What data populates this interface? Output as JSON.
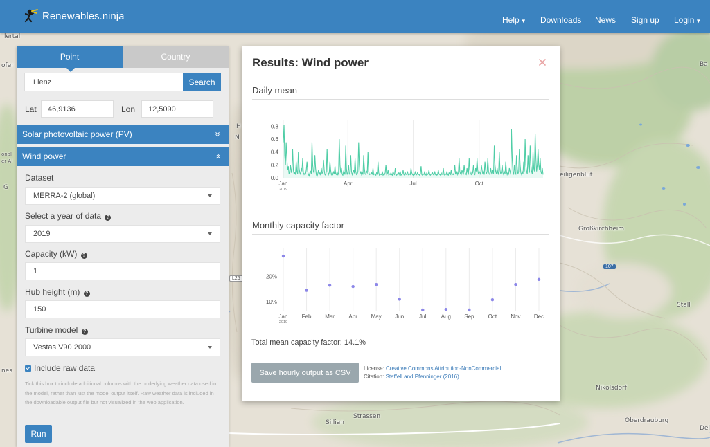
{
  "app": {
    "brand": "Renewables.ninja",
    "nav": [
      "Help",
      "Downloads",
      "News",
      "Sign up",
      "Login"
    ],
    "colors": {
      "primary": "#3b83c0",
      "panel_bg": "#ececec",
      "chart_line": "#4fcda6",
      "chart_dot": "#8c87e8"
    }
  },
  "map": {
    "labels": [
      "lertal",
      "Ba",
      "ofer",
      "H",
      "N",
      "onal",
      "er Al",
      "G",
      "eiligenblut",
      "Großkirchheim",
      "Stall",
      "Nikolsdorf",
      "Sillian",
      "Strassen",
      "Oberdrauburg",
      "Del",
      "nes"
    ],
    "road_badges": [
      "L25",
      "107"
    ]
  },
  "panel": {
    "tabs": [
      "Point",
      "Country"
    ],
    "search": {
      "value": "Lienz",
      "button": "Search"
    },
    "lat_label": "Lat",
    "lat_value": "46,9136",
    "lon_label": "Lon",
    "lon_value": "12,5090",
    "sections": [
      {
        "label": "Solar photovoltaic power (PV)",
        "icon": "double-chevron-down"
      },
      {
        "label": "Wind power",
        "icon": "double-chevron-up"
      }
    ],
    "fields": {
      "dataset": {
        "label": "Dataset",
        "value": "MERRA-2 (global)"
      },
      "year": {
        "label": "Select a year of data",
        "value": "2019"
      },
      "capacity": {
        "label": "Capacity (kW)",
        "value": "1"
      },
      "hub_height": {
        "label": "Hub height (m)",
        "value": "150"
      },
      "turbine": {
        "label": "Turbine model",
        "value": "Vestas V90 2000"
      }
    },
    "include_raw": {
      "label": "Include raw data",
      "checked": true,
      "help": "Tick this box to include additional columns with the underlying weather data used in the model, rather than just the model output itself. Raw weather data is included in the downloadable output file but not visualized in the web application."
    },
    "run_button": "Run"
  },
  "results": {
    "title": "Results: Wind power",
    "daily_title": "Daily mean",
    "monthly_title": "Monthly capacity factor",
    "total_text": "Total mean capacity factor: 14.1%",
    "save_button": "Save hourly output as CSV",
    "license_label": "License:",
    "license_link": "Creative Commons Attribution-NonCommercial",
    "citation_label": "Citation:",
    "citation_link": "Staffell and Pfenninger (2016)"
  },
  "chart_data": [
    {
      "type": "area",
      "title": "Daily mean",
      "x_ticks": [
        "Jan",
        "Apr",
        "Jul",
        "Oct"
      ],
      "x_tick_sub": "2019",
      "ylim": [
        0,
        0.9
      ],
      "y_ticks": [
        0.0,
        0.2,
        0.4,
        0.6,
        0.8
      ],
      "series": [
        {
          "values": [
            0.55,
            0.82,
            0.35,
            0.2,
            0.55,
            0.3,
            0.12,
            0.18,
            0.06,
            0.1,
            0.2,
            0.08,
            0.15,
            0.45,
            0.12,
            0.06,
            0.08,
            0.05,
            0.25,
            0.1,
            0.06,
            0.4,
            0.15,
            0.08,
            0.05,
            0.15,
            0.1,
            0.3,
            0.08,
            0.05,
            0.07,
            0.06,
            0.12,
            0.25,
            0.1,
            0.05,
            0.03,
            0.08,
            0.1,
            0.06,
            0.55,
            0.2,
            0.1,
            0.07,
            0.35,
            0.15,
            0.05,
            0.02,
            0.06,
            0.12,
            0.05,
            0.08,
            0.04,
            0.15,
            0.06,
            0.1,
            0.28,
            0.12,
            0.05,
            0.04,
            0.1,
            0.45,
            0.1,
            0.05,
            0.08,
            0.25,
            0.12,
            0.05,
            0.07,
            0.05,
            0.1,
            0.06,
            0.18,
            0.06,
            0.05,
            0.1,
            0.04,
            0.08,
            0.6,
            0.2,
            0.08,
            0.15,
            0.06,
            0.04,
            0.1,
            0.08,
            0.05,
            0.5,
            0.15,
            0.05,
            0.08,
            0.2,
            0.06,
            0.05,
            0.35,
            0.1,
            0.05,
            0.08,
            0.12,
            0.07,
            0.3,
            0.1,
            0.05,
            0.06,
            0.1,
            0.55,
            0.2,
            0.06,
            0.1,
            0.05,
            0.08,
            0.05,
            0.35,
            0.15,
            0.06,
            0.05,
            0.1,
            0.08,
            0.4,
            0.1,
            0.05,
            0.06,
            0.05,
            0.08,
            0.05,
            0.15,
            0.05,
            0.06,
            0.05,
            0.04,
            0.08,
            0.05,
            0.25,
            0.08,
            0.04,
            0.06,
            0.05,
            0.05,
            0.1,
            0.04,
            0.06,
            0.05,
            0.08,
            0.2,
            0.05,
            0.06,
            0.12,
            0.04,
            0.06,
            0.05,
            0.08,
            0.05,
            0.04,
            0.1,
            0.06,
            0.05,
            0.15,
            0.05,
            0.04,
            0.06,
            0.05,
            0.08,
            0.05,
            0.1,
            0.04,
            0.05,
            0.06,
            0.12,
            0.05,
            0.04,
            0.08,
            0.05,
            0.06,
            0.1,
            0.05,
            0.04,
            0.06,
            0.05,
            0.15,
            0.08,
            0.05,
            0.04,
            0.06,
            0.05,
            0.1,
            0.04,
            0.05,
            0.08,
            0.06,
            0.05,
            0.04,
            0.06,
            0.18,
            0.05,
            0.04,
            0.06,
            0.05,
            0.1,
            0.05,
            0.04,
            0.08,
            0.05,
            0.06,
            0.12,
            0.05,
            0.04,
            0.06,
            0.05,
            0.08,
            0.05,
            0.04,
            0.1,
            0.05,
            0.06,
            0.04,
            0.05,
            0.12,
            0.06,
            0.05,
            0.04,
            0.08,
            0.05,
            0.06,
            0.15,
            0.05,
            0.04,
            0.06,
            0.05,
            0.1,
            0.05,
            0.04,
            0.08,
            0.06,
            0.05,
            0.12,
            0.04,
            0.06,
            0.05,
            0.08,
            0.2,
            0.06,
            0.05,
            0.1,
            0.05,
            0.08,
            0.3,
            0.1,
            0.06,
            0.05,
            0.12,
            0.08,
            0.05,
            0.2,
            0.1,
            0.06,
            0.05,
            0.15,
            0.08,
            0.05,
            0.3,
            0.12,
            0.06,
            0.05,
            0.1,
            0.08,
            0.2,
            0.06,
            0.05,
            0.15,
            0.1,
            0.3,
            0.12,
            0.06,
            0.1,
            0.08,
            0.05,
            0.2,
            0.12,
            0.06,
            0.1,
            0.05,
            0.25,
            0.12,
            0.06,
            0.1,
            0.3,
            0.1,
            0.06,
            0.05,
            0.15,
            0.08,
            0.05,
            0.12,
            0.06,
            0.5,
            0.2,
            0.1,
            0.06,
            0.15,
            0.08,
            0.05,
            0.4,
            0.12,
            0.06,
            0.1,
            0.2,
            0.08,
            0.05,
            0.1,
            0.06,
            0.25,
            0.1,
            0.05,
            0.08,
            0.06,
            0.15,
            0.1,
            0.05,
            0.75,
            0.3,
            0.1,
            0.05,
            0.2,
            0.08,
            0.06,
            0.35,
            0.15,
            0.06,
            0.1,
            0.45,
            0.2,
            0.08,
            0.05,
            0.1,
            0.06,
            0.25,
            0.1,
            0.6,
            0.2,
            0.1,
            0.06,
            0.35,
            0.15,
            0.08,
            0.5,
            0.2,
            0.1,
            0.06,
            0.4,
            0.15,
            0.1,
            0.68,
            0.3,
            0.1,
            0.2,
            0.45,
            0.2,
            0.12,
            0.3,
            0.1,
            0.06,
            0.15,
            0.05
          ]
        }
      ]
    },
    {
      "type": "scatter",
      "title": "Monthly capacity factor",
      "categories": [
        "Jan",
        "Feb",
        "Mar",
        "Apr",
        "May",
        "Jun",
        "Jul",
        "Aug",
        "Sep",
        "Oct",
        "Nov",
        "Dec"
      ],
      "x_tick_sub": "2019",
      "values": [
        28.0,
        14.5,
        16.5,
        16.0,
        16.8,
        11.0,
        6.8,
        7.0,
        6.8,
        10.8,
        16.8,
        18.8
      ],
      "unit": "%",
      "ylim": [
        6.5,
        31
      ],
      "y_ticks": [
        10,
        20
      ],
      "y_tick_labels": [
        "10%",
        "20%"
      ]
    }
  ]
}
